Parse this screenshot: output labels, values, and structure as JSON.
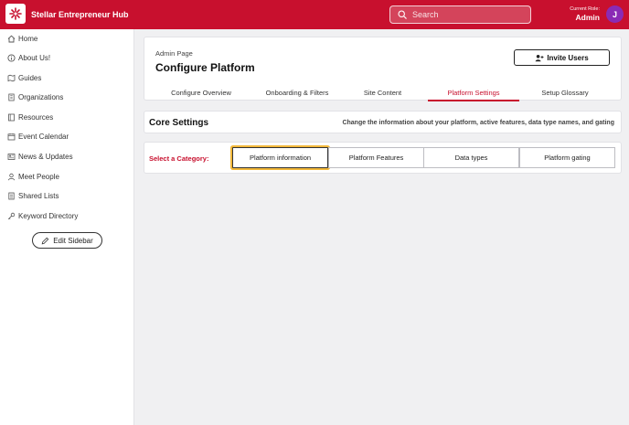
{
  "header": {
    "app_title": "Stellar Entrepreneur Hub",
    "search_placeholder": "Search",
    "role_label": "Current Role:",
    "role_value": "Admin",
    "avatar_initial": "J"
  },
  "sidebar": {
    "items": [
      {
        "label": "Home",
        "icon": "home-icon"
      },
      {
        "label": "About Us!",
        "icon": "info-icon"
      },
      {
        "label": "Guides",
        "icon": "map-icon"
      },
      {
        "label": "Organizations",
        "icon": "building-icon"
      },
      {
        "label": "Resources",
        "icon": "book-icon"
      },
      {
        "label": "Event Calendar",
        "icon": "calendar-icon"
      },
      {
        "label": "News & Updates",
        "icon": "news-icon"
      },
      {
        "label": "Meet People",
        "icon": "person-icon"
      },
      {
        "label": "Shared Lists",
        "icon": "list-icon"
      },
      {
        "label": "Keyword Directory",
        "icon": "key-icon"
      }
    ],
    "edit_label": "Edit Sidebar"
  },
  "admin": {
    "label": "Admin Page",
    "title": "Configure Platform",
    "invite_label": "Invite Users",
    "tabs": [
      {
        "label": "Configure Overview"
      },
      {
        "label": "Onboarding & Filters"
      },
      {
        "label": "Site Content"
      },
      {
        "label": "Platform Settings",
        "active": true
      },
      {
        "label": "Setup Glossary"
      }
    ]
  },
  "core": {
    "title": "Core Settings",
    "description": "Change the information about your platform, active features, data type names, and gating"
  },
  "category": {
    "label": "Select a Category:",
    "options": [
      {
        "label": "Platform information",
        "selected": true
      },
      {
        "label": "Platform Features"
      },
      {
        "label": "Data types"
      },
      {
        "label": "Platform gating"
      }
    ]
  },
  "colors": {
    "brand": "#c8102e",
    "avatar": "#8a2bb5",
    "focus": "#f2b83a"
  }
}
